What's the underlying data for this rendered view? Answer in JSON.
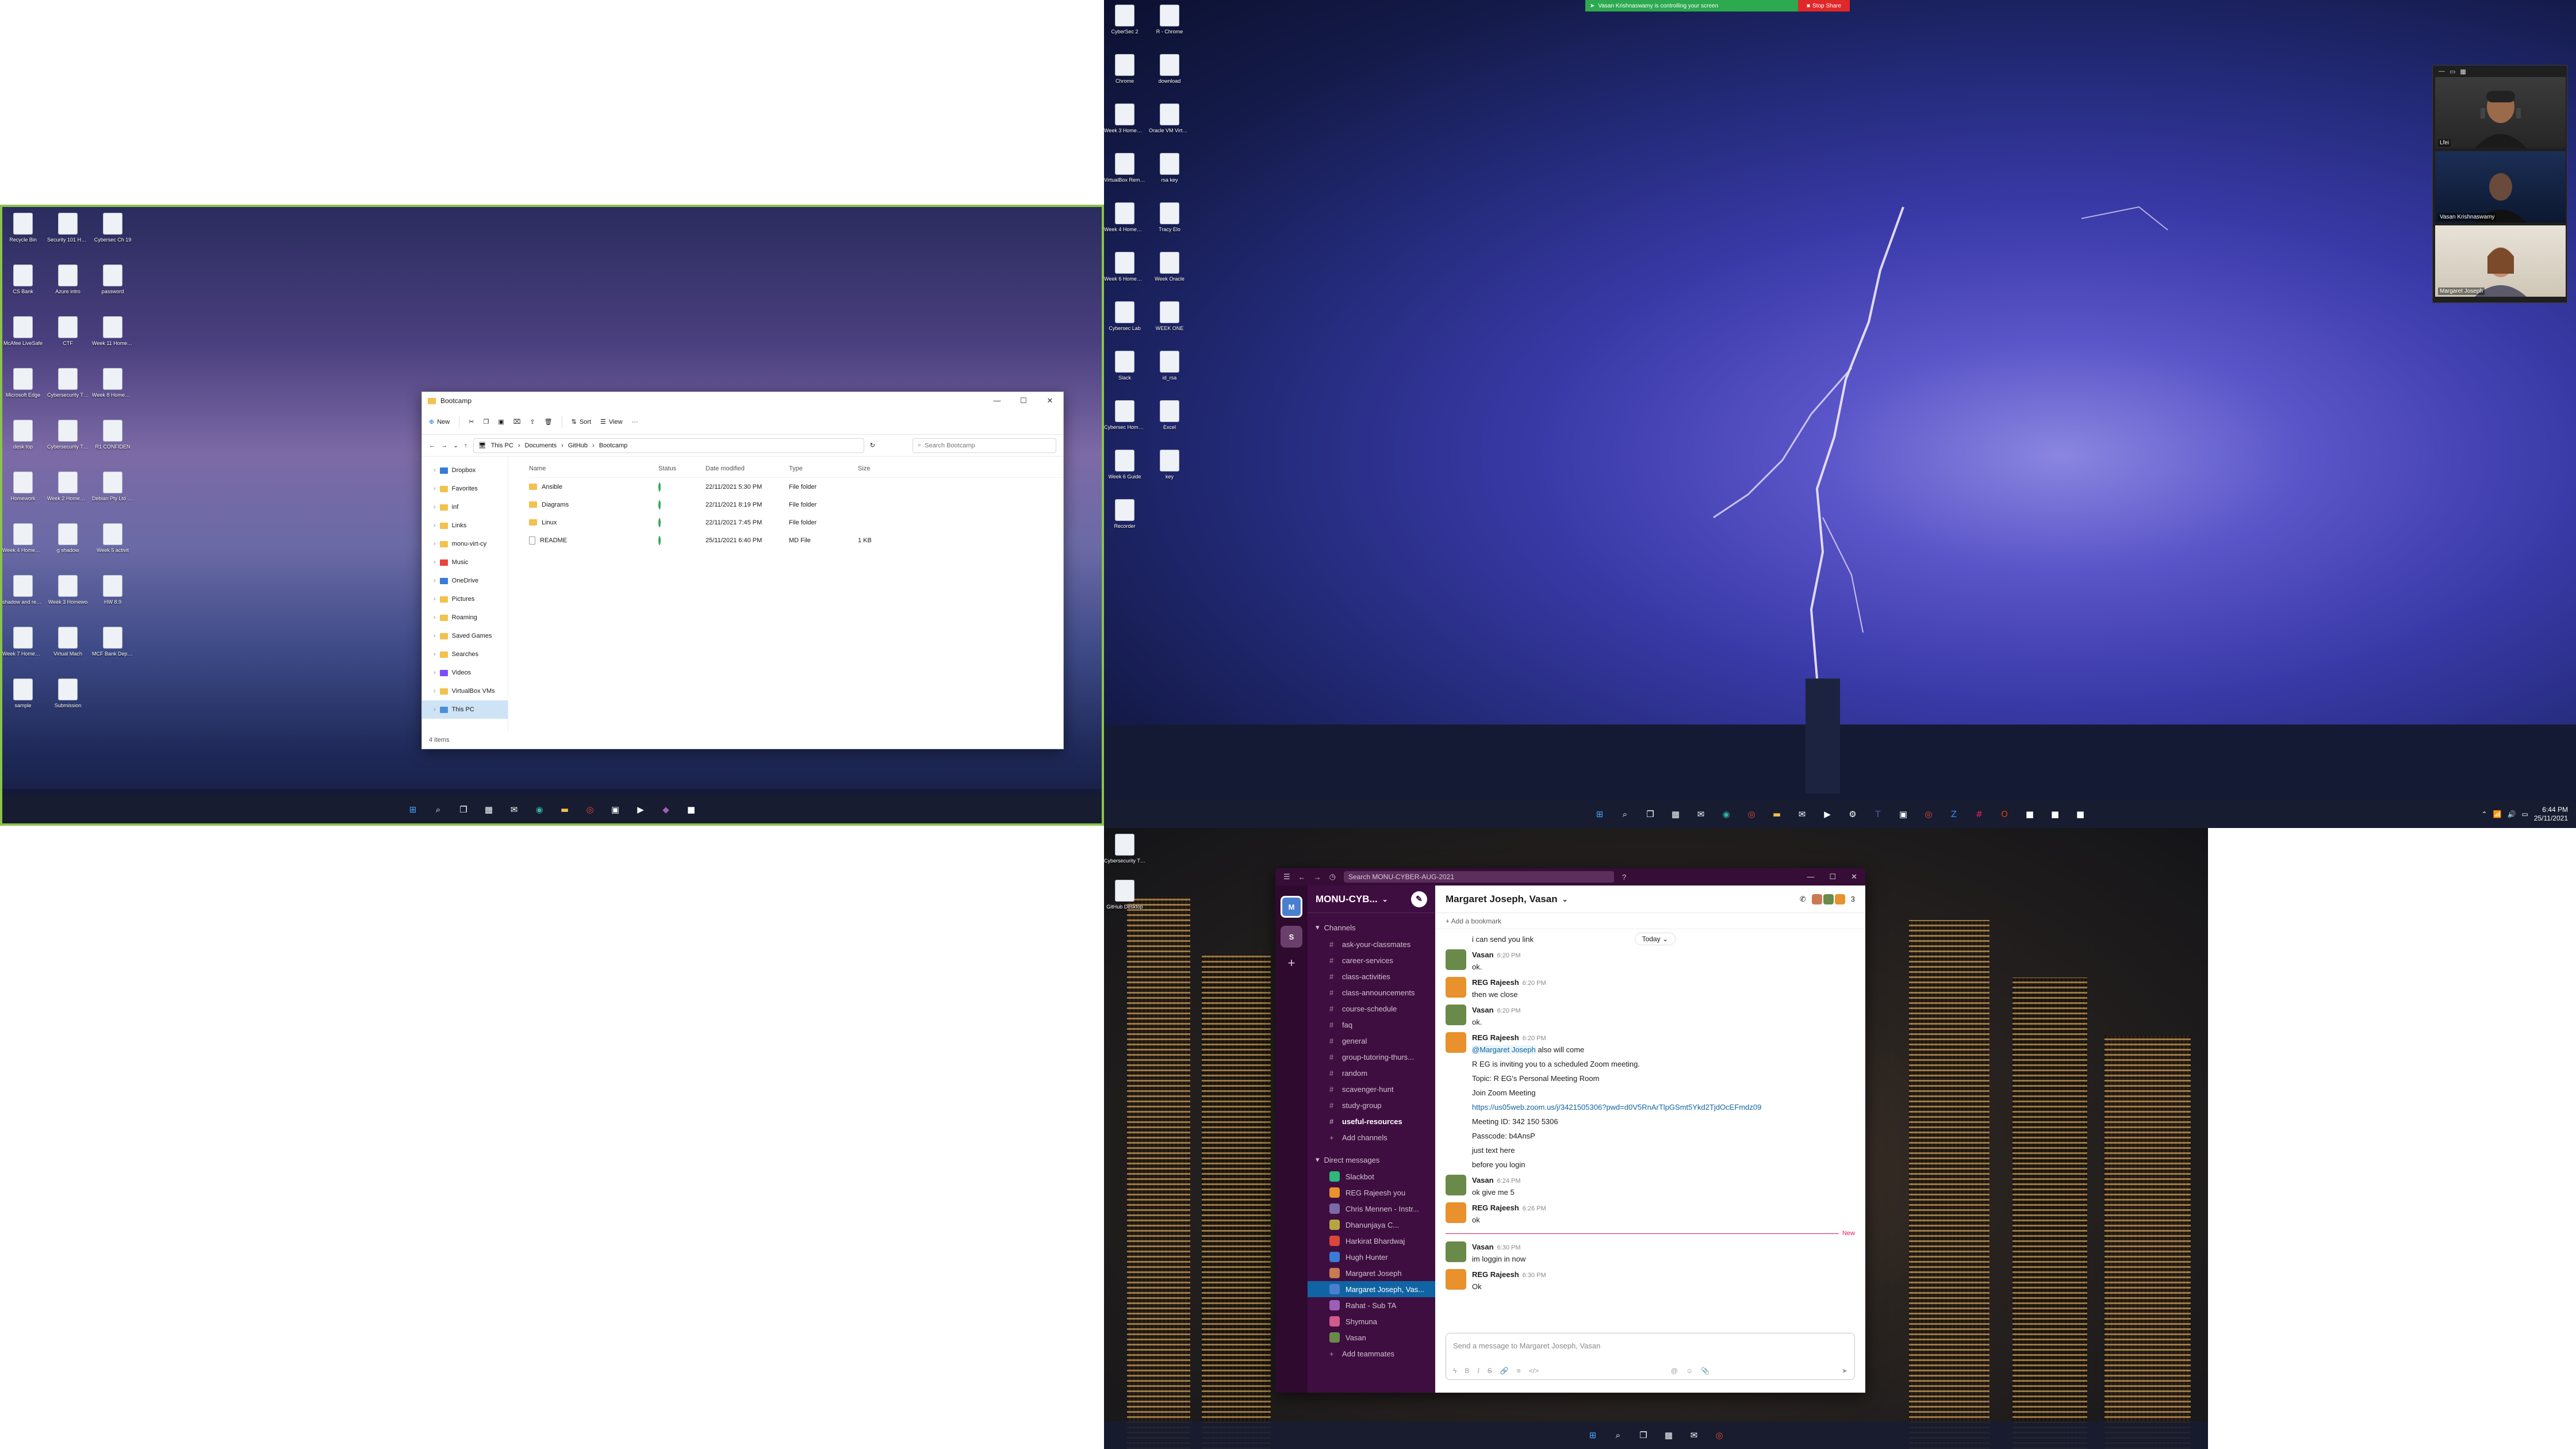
{
  "monitors": {
    "left": {
      "desktop_icons": [
        {
          "label": "Recycle Bin",
          "icon": "recycle-bin-icon"
        },
        {
          "label": "Security 101 Homework",
          "icon": "doc-icon"
        },
        {
          "label": "Cybersec Ch 19",
          "icon": "doc-icon"
        },
        {
          "label": "CS Bank",
          "icon": "app-icon"
        },
        {
          "label": "Azure intro",
          "icon": "doc-icon"
        },
        {
          "label": "password",
          "icon": "doc-icon"
        },
        {
          "label": "McAfee LiveSafe",
          "icon": "mcafee-icon"
        },
        {
          "label": "CTF",
          "icon": "app-icon"
        },
        {
          "label": "Week 11 Homework",
          "icon": "doc-icon"
        },
        {
          "label": "Microsoft Edge",
          "icon": "edge-icon"
        },
        {
          "label": "Cybersecurity Threat Lan",
          "icon": "doc-icon"
        },
        {
          "label": "Week 8 Homework",
          "icon": "doc-icon"
        },
        {
          "label": "desk top",
          "icon": "folder-icon"
        },
        {
          "label": "Cybersecurity Threat Lan",
          "icon": "doc-icon"
        },
        {
          "label": "R1 CONFIDEN",
          "icon": "doc-icon"
        },
        {
          "label": "Homework",
          "icon": "folder-icon"
        },
        {
          "label": "Week 2 Homework",
          "icon": "doc-icon"
        },
        {
          "label": "Debian Pty Ltd Invoi",
          "icon": "doc-icon"
        },
        {
          "label": "Week 4 Homework",
          "icon": "doc-icon"
        },
        {
          "label": "g shadow",
          "icon": "key-icon"
        },
        {
          "label": "Week 5 activit",
          "icon": "doc-icon"
        },
        {
          "label": "shadow and review",
          "icon": "key-icon"
        },
        {
          "label": "Week 3 Homewo",
          "icon": "doc-icon"
        },
        {
          "label": "HW 8.9",
          "icon": "doc-icon"
        },
        {
          "label": "Week 7 Homework",
          "icon": "doc-icon"
        },
        {
          "label": "Virtual Mach",
          "icon": "vm-icon"
        },
        {
          "label": "MCF Bank Deposit Sl",
          "icon": "doc-icon"
        },
        {
          "label": "sample",
          "icon": "doc-icon"
        },
        {
          "label": "Submission",
          "icon": "doc-icon"
        }
      ],
      "taskbar_icons": [
        "windows-start-icon",
        "search-icon",
        "task-view-icon",
        "widgets-icon",
        "chat-icon",
        "edge-icon",
        "folder-icon",
        "chrome-icon",
        "store-icon",
        "terminal-icon",
        "visual-studio-icon",
        "app-icon"
      ]
    },
    "right": {
      "desktop_icons": [
        {
          "label": "CyberSec 2",
          "icon": "doc-icon"
        },
        {
          "label": "R - Chrome",
          "icon": "chrome-icon"
        },
        {
          "label": "Chrome",
          "icon": "chrome-icon"
        },
        {
          "label": "download",
          "icon": "doc-icon"
        },
        {
          "label": "Week 3 Homework",
          "icon": "doc-icon"
        },
        {
          "label": "Oracle VM VirtualBox",
          "icon": "vm-icon"
        },
        {
          "label": "VirtualBox Remote",
          "icon": "vm-icon"
        },
        {
          "label": "rsa key",
          "icon": "key-icon"
        },
        {
          "label": "Week 4 Homework",
          "icon": "doc-icon"
        },
        {
          "label": "Tracy Elo",
          "icon": "doc-icon"
        },
        {
          "label": "Week 6 Homework",
          "icon": "doc-icon"
        },
        {
          "label": "Week Oracle",
          "icon": "doc-icon"
        },
        {
          "label": "Cybersec Lab",
          "icon": "doc-icon"
        },
        {
          "label": "WEEK ONE",
          "icon": "excel-icon"
        },
        {
          "label": "Slack",
          "icon": "app-icon"
        },
        {
          "label": "id_rsa",
          "icon": "key-icon"
        },
        {
          "label": "Cybersec Homework",
          "icon": "doc-icon"
        },
        {
          "label": "Excel",
          "icon": "excel-icon"
        },
        {
          "label": "Week 6 Guide",
          "icon": "doc-icon"
        },
        {
          "label": "key",
          "icon": "key-icon"
        },
        {
          "label": "Recorder",
          "icon": "app-icon"
        }
      ],
      "taskbar_icons": [
        "windows-start-icon",
        "search-icon",
        "task-view-icon",
        "widgets-icon",
        "chat-icon",
        "edge-icon",
        "chrome-icon",
        "folder-icon",
        "mail-icon",
        "terminal-icon",
        "settings-icon",
        "teams-icon",
        "store-icon",
        "chrome-icon",
        "zoom-icon",
        "slack-icon",
        "office-icon",
        "app-icon",
        "app-icon",
        "app-icon"
      ],
      "tray": {
        "time": "6:44 PM",
        "date": "25/11/2021"
      }
    },
    "bottom": {
      "desktop_icons": [
        {
          "label": "Cybersecurity Threat",
          "icon": "doc-icon"
        },
        {
          "label": "GitHub Desktop",
          "icon": "github-icon"
        }
      ],
      "taskbar_icons": [
        "windows-start-icon",
        "search-icon",
        "task-view-icon",
        "widgets-icon",
        "chat-icon",
        "chrome-icon"
      ]
    }
  },
  "explorer": {
    "title": "Bootcamp",
    "window_controls": [
      "—",
      "☐",
      "✕"
    ],
    "toolbar": {
      "new": "New",
      "sort": "Sort",
      "view": "View",
      "more": "···"
    },
    "address": {
      "parts": [
        "This PC",
        "Documents",
        "GitHub",
        "Bootcamp"
      ],
      "search_placeholder": "Search Bootcamp"
    },
    "nav": [
      {
        "label": "Dropbox",
        "icon": "dropbox-icon"
      },
      {
        "label": "Favorites",
        "icon": "folder-icon"
      },
      {
        "label": "inf",
        "icon": "folder-icon"
      },
      {
        "label": "Links",
        "icon": "folder-icon"
      },
      {
        "label": "monu-virt-cy",
        "icon": "folder-icon"
      },
      {
        "label": "Music",
        "icon": "music-icon"
      },
      {
        "label": "OneDrive",
        "icon": "onedrive-icon"
      },
      {
        "label": "Pictures",
        "icon": "folder-icon"
      },
      {
        "label": "Roaming",
        "icon": "folder-icon"
      },
      {
        "label": "Saved Games",
        "icon": "folder-icon"
      },
      {
        "label": "Searches",
        "icon": "folder-icon"
      },
      {
        "label": "Videos",
        "icon": "video-icon"
      },
      {
        "label": "VirtualBox VMs",
        "icon": "folder-icon"
      },
      {
        "label": "This PC",
        "icon": "pc-icon",
        "selected": true
      }
    ],
    "columns": [
      "Name",
      "Status",
      "Date modified",
      "Type",
      "Size"
    ],
    "rows": [
      {
        "name": "Ansible",
        "date": "22/11/2021 5:30 PM",
        "type": "File folder",
        "size": "",
        "folder": true
      },
      {
        "name": "Diagrams",
        "date": "22/11/2021 8:19 PM",
        "type": "File folder",
        "size": "",
        "folder": true
      },
      {
        "name": "Linux",
        "date": "22/11/2021 7:45 PM",
        "type": "File folder",
        "size": "",
        "folder": true
      },
      {
        "name": "README",
        "date": "25/11/2021 6:40 PM",
        "type": "MD File",
        "size": "1 KB",
        "folder": false
      }
    ],
    "status": "4 items"
  },
  "zoom": {
    "banner_text": "Vasan Krishnaswamy is controlling your screen",
    "stop_label": "Stop Share",
    "participants": [
      {
        "name": "Lfei"
      },
      {
        "name": "Vasan Krishnaswamy"
      },
      {
        "name": "Margaret Joseph"
      }
    ]
  },
  "slack": {
    "search_placeholder": "Search MONU-CYBER-AUG-2021",
    "workspace": "MONU-CYB...",
    "channels_header": "Channels",
    "channels": [
      {
        "name": "ask-your-classmates",
        "bold": false
      },
      {
        "name": "career-services",
        "bold": false
      },
      {
        "name": "class-activities",
        "bold": false
      },
      {
        "name": "class-announcements",
        "bold": false
      },
      {
        "name": "course-schedule",
        "bold": false
      },
      {
        "name": "faq",
        "bold": false
      },
      {
        "name": "general",
        "bold": false
      },
      {
        "name": "group-tutoring-thurs...",
        "bold": false
      },
      {
        "name": "random",
        "bold": false
      },
      {
        "name": "scavenger-hunt",
        "bold": false
      },
      {
        "name": "study-group",
        "bold": false
      },
      {
        "name": "useful-resources",
        "bold": true
      }
    ],
    "add_channels": "Add channels",
    "dm_header": "Direct messages",
    "dms": [
      {
        "name": "Slackbot",
        "color": "#2eb67d",
        "selected": false
      },
      {
        "name": "REG Rajeesh  you",
        "color": "#e8912d",
        "selected": false
      },
      {
        "name": "Chris Mennen - Instr...",
        "color": "#7c6aa6",
        "selected": false
      },
      {
        "name": "Dhanunjaya C...",
        "color": "#b5a642",
        "selected": false
      },
      {
        "name": "Harkirat Bhardwaj",
        "color": "#d8473a",
        "selected": false
      },
      {
        "name": "Hugh Hunter",
        "color": "#3a7bd5",
        "selected": false
      },
      {
        "name": "Margaret Joseph",
        "color": "#c97a52",
        "selected": false
      },
      {
        "name": "Margaret Joseph, Vas...",
        "color": "#4a7fd0",
        "selected": true
      },
      {
        "name": "Rahat - Sub TA",
        "color": "#9b5fb5",
        "selected": false
      },
      {
        "name": "Shymuna",
        "color": "#d15a8a",
        "selected": false
      },
      {
        "name": "Vasan",
        "color": "#6a8a4a",
        "selected": false
      }
    ],
    "add_teammates": "Add teammates",
    "channel_title": "Margaret Joseph, Vasan",
    "member_count": "3",
    "bookmark": "+ Add a bookmark",
    "today": "Today",
    "messages": [
      {
        "type": "cont",
        "text": "i can send you link"
      },
      {
        "type": "msg",
        "author": "Vasan",
        "time": "6:20 PM",
        "color": "#6a8a4a",
        "lines": [
          "ok."
        ]
      },
      {
        "type": "msg",
        "author": "REG Rajeesh",
        "time": "6:20 PM",
        "color": "#e8912d",
        "lines": [
          "then we close"
        ]
      },
      {
        "type": "msg",
        "author": "Vasan",
        "time": "6:20 PM",
        "color": "#6a8a4a",
        "lines": [
          "ok."
        ]
      },
      {
        "type": "msg",
        "author": "REG Rajeesh",
        "time": "6:20 PM",
        "color": "#e8912d",
        "mention": "@Margaret Joseph",
        "lines": [
          "also will come"
        ]
      },
      {
        "type": "cont",
        "text": "R EG is inviting you to a scheduled Zoom meeting."
      },
      {
        "type": "cont",
        "text": "Topic: R EG's Personal Meeting Room"
      },
      {
        "type": "cont",
        "text": "Join Zoom Meeting"
      },
      {
        "type": "link",
        "text": "https://us05web.zoom.us/j/3421505306?pwd=d0V5RnArTlpGSmt5Ykd2TjdOcEFmdz09"
      },
      {
        "type": "cont",
        "text": "Meeting ID: 342 150 5306"
      },
      {
        "type": "cont",
        "text": "Passcode: b4AnsP"
      },
      {
        "type": "cont",
        "text": "just text here"
      },
      {
        "type": "cont",
        "text": "before you login"
      },
      {
        "type": "msg",
        "author": "Vasan",
        "time": "6:24 PM",
        "color": "#6a8a4a",
        "lines": [
          "ok give me 5"
        ]
      },
      {
        "type": "msg",
        "author": "REG Rajeesh",
        "time": "6:26 PM",
        "color": "#e8912d",
        "lines": [
          "ok"
        ]
      },
      {
        "type": "new",
        "text": "New"
      },
      {
        "type": "msg",
        "author": "Vasan",
        "time": "6:30 PM",
        "color": "#6a8a4a",
        "lines": [
          "im loggin in now"
        ]
      },
      {
        "type": "msg",
        "author": "REG Rajeesh",
        "time": "6:30 PM",
        "color": "#e8912d",
        "lines": [
          "Ok"
        ]
      }
    ],
    "composer_placeholder": "Send a message to Margaret Joseph, Vasan"
  }
}
